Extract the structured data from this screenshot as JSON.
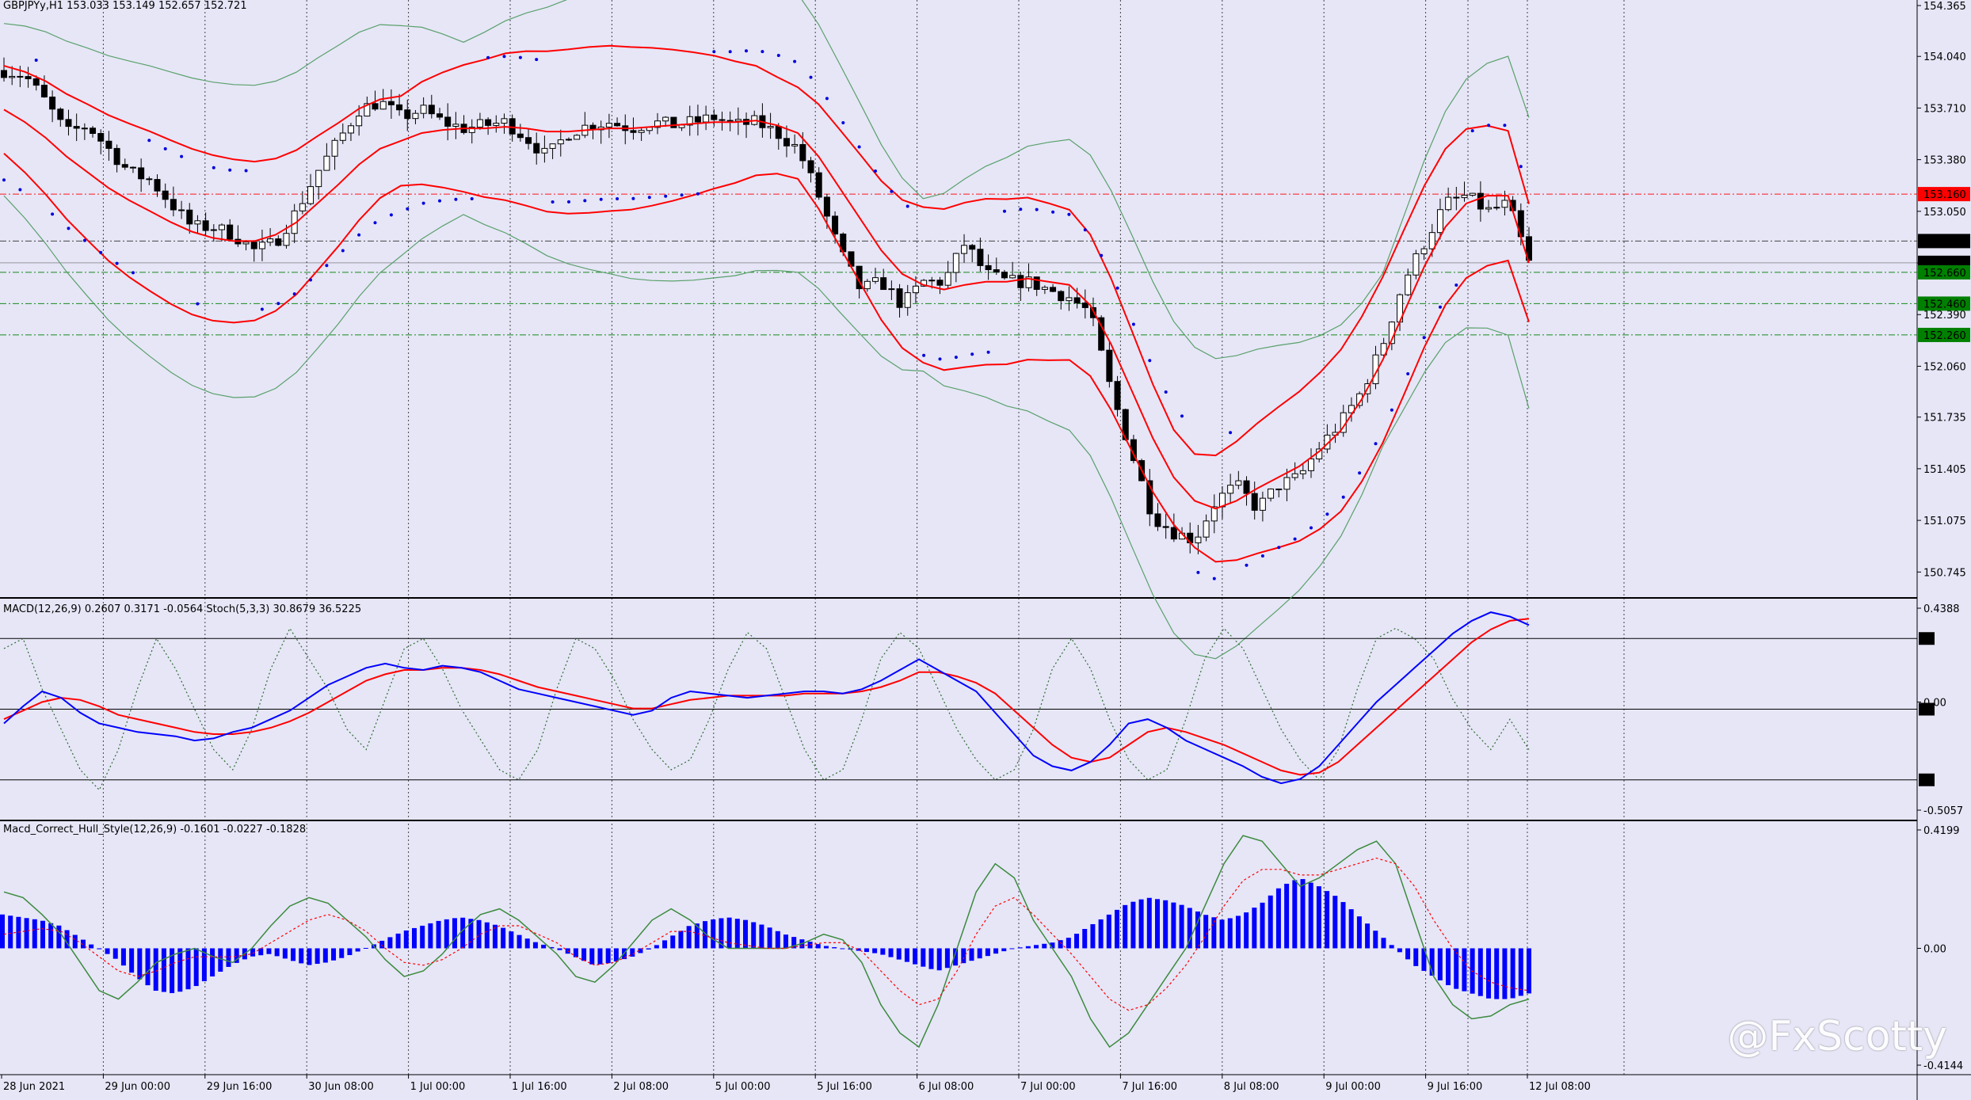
{
  "header": {
    "symbol_line": "GBPJPYy,H1  153.033 153.149 152.657 152.721"
  },
  "indicators": {
    "macd_label": "MACD(12,26,9) 0.2607 0.3171 -0.0564  Stoch(5,3,3) 30.8679 36.5225",
    "hull_label": "Macd_Correct_Hull_Style(12,26,9) -0.1601 -0.0227 -0.1828"
  },
  "watermark": "@FxScotty",
  "colors": {
    "background": "#e6e6f7",
    "bull_candle": "#ffffff",
    "bear_candle": "#000000",
    "ma_red": "#ff0000",
    "bands_green": "#5aa06a",
    "sar_blue": "#0000dd",
    "macd_main": "#0000ff",
    "macd_signal": "#ff0000",
    "stoch_dotted": "#2e6b2e",
    "hist_blue": "#0000ff",
    "marker_red": "#ff0000",
    "marker_black": "#000000",
    "marker_green": "#008000"
  },
  "chart_data": [
    {
      "type": "candlestick",
      "title": "GBPJPYy,H1",
      "y_ticks": [
        "154.365",
        "154.040",
        "153.710",
        "153.380",
        "153.050",
        "152.720",
        "152.390",
        "152.060",
        "151.735",
        "151.405",
        "151.075",
        "150.745"
      ],
      "ylim": [
        150.62,
        154.37
      ],
      "x_ticks": [
        "28 Jun 2021",
        "29 Jun 00:00",
        "29 Jun 16:00",
        "30 Jun 08:00",
        "1 Jul 00:00",
        "1 Jul 16:00",
        "2 Jul 08:00",
        "5 Jul 00:00",
        "5 Jul 16:00",
        "6 Jul 08:00",
        "7 Jul 00:00",
        "7 Jul 16:00",
        "8 Jul 08:00",
        "9 Jul 00:00",
        "9 Jul 16:00",
        "12 Jul 08:00"
      ],
      "price_markers": [
        {
          "value": "153.160",
          "style": "red"
        },
        {
          "value": "152.860",
          "style": "black"
        },
        {
          "value": "152.721",
          "style": "black"
        },
        {
          "value": "152.660",
          "style": "green"
        },
        {
          "value": "152.460",
          "style": "green"
        },
        {
          "value": "152.260",
          "style": "green"
        }
      ],
      "close_path": [
        153.95,
        153.92,
        153.75,
        153.55,
        153.6,
        153.45,
        153.3,
        153.25,
        153.1,
        152.95,
        152.95,
        152.9,
        152.8,
        152.85,
        153.05,
        153.3,
        153.5,
        153.7,
        153.75,
        153.65,
        153.7,
        153.62,
        153.58,
        153.6,
        153.62,
        153.52,
        153.4,
        153.55,
        153.6,
        153.62,
        153.58,
        153.62,
        153.6,
        153.62,
        153.65,
        153.6,
        153.62,
        153.55,
        153.45,
        153.15,
        152.8,
        152.55,
        152.6,
        152.45,
        152.6,
        152.6,
        152.85,
        152.65,
        152.6,
        152.6,
        152.55,
        152.5,
        152.4,
        151.9,
        151.5,
        151.1,
        151.0,
        150.95,
        151.2,
        151.3,
        151.15,
        151.3,
        151.35,
        151.55,
        151.7,
        151.9,
        152.2,
        152.6,
        152.85,
        153.1,
        153.15,
        153.05,
        153.1,
        152.72
      ],
      "series": [
        {
          "name": "MA",
          "values": [
            153.7,
            153.62,
            153.52,
            153.4,
            153.3,
            153.2,
            153.12,
            153.05,
            152.98,
            152.92,
            152.88,
            152.86,
            152.86,
            152.9,
            152.98,
            153.1,
            153.22,
            153.35,
            153.45,
            153.5,
            153.55,
            153.57,
            153.58,
            153.58,
            153.59,
            153.58,
            153.56,
            153.56,
            153.57,
            153.58,
            153.58,
            153.59,
            153.6,
            153.61,
            153.62,
            153.62,
            153.63,
            153.6,
            153.55,
            153.4,
            153.2,
            153.0,
            152.8,
            152.65,
            152.58,
            152.55,
            152.58,
            152.6,
            152.6,
            152.62,
            152.6,
            152.58,
            152.45,
            152.2,
            151.9,
            151.6,
            151.35,
            151.2,
            151.15,
            151.2,
            151.28,
            151.35,
            151.42,
            151.52,
            151.65,
            151.85,
            152.1,
            152.4,
            152.7,
            152.95,
            153.1,
            153.15,
            153.15,
            152.72
          ]
        }
      ]
    },
    {
      "type": "line",
      "title": "MACD(12,26,9) 0.2607 0.3171 -0.0564  Stoch(5,3,3) 30.8679 36.5225",
      "y_ticks": [
        "0.4388",
        "0.00",
        "-0.5057"
      ],
      "levels": [
        "85",
        "50",
        "15"
      ],
      "ylim": [
        -0.5057,
        0.4388
      ],
      "series": [
        {
          "name": "MACD",
          "values": [
            -0.1,
            -0.02,
            0.05,
            0.02,
            -0.05,
            -0.1,
            -0.12,
            -0.14,
            -0.15,
            -0.16,
            -0.18,
            -0.17,
            -0.14,
            -0.12,
            -0.08,
            -0.04,
            0.02,
            0.08,
            0.12,
            0.16,
            0.18,
            0.16,
            0.15,
            0.17,
            0.16,
            0.14,
            0.1,
            0.06,
            0.04,
            0.02,
            0.0,
            -0.02,
            -0.04,
            -0.06,
            -0.04,
            0.02,
            0.05,
            0.04,
            0.03,
            0.02,
            0.03,
            0.04,
            0.05,
            0.05,
            0.04,
            0.06,
            0.1,
            0.15,
            0.2,
            0.15,
            0.1,
            0.05,
            -0.05,
            -0.15,
            -0.25,
            -0.3,
            -0.32,
            -0.28,
            -0.2,
            -0.1,
            -0.08,
            -0.12,
            -0.18,
            -0.22,
            -0.26,
            -0.3,
            -0.35,
            -0.38,
            -0.36,
            -0.3,
            -0.2,
            -0.1,
            0.0,
            0.08,
            0.16,
            0.24,
            0.32,
            0.38,
            0.42,
            0.4,
            0.36
          ]
        },
        {
          "name": "Signal",
          "values": [
            -0.08,
            -0.04,
            0.0,
            0.02,
            0.01,
            -0.02,
            -0.06,
            -0.08,
            -0.1,
            -0.12,
            -0.14,
            -0.15,
            -0.15,
            -0.14,
            -0.12,
            -0.09,
            -0.05,
            0.0,
            0.05,
            0.1,
            0.13,
            0.15,
            0.15,
            0.16,
            0.16,
            0.15,
            0.13,
            0.1,
            0.07,
            0.05,
            0.03,
            0.01,
            -0.01,
            -0.03,
            -0.03,
            -0.01,
            0.01,
            0.02,
            0.03,
            0.03,
            0.03,
            0.03,
            0.04,
            0.04,
            0.04,
            0.05,
            0.07,
            0.1,
            0.14,
            0.14,
            0.12,
            0.09,
            0.04,
            -0.04,
            -0.12,
            -0.2,
            -0.26,
            -0.28,
            -0.26,
            -0.2,
            -0.14,
            -0.12,
            -0.14,
            -0.17,
            -0.2,
            -0.24,
            -0.28,
            -0.32,
            -0.34,
            -0.33,
            -0.28,
            -0.2,
            -0.12,
            -0.04,
            0.04,
            0.12,
            0.2,
            0.28,
            0.34,
            0.38,
            0.39
          ]
        },
        {
          "name": "Stoch",
          "values": [
            80,
            85,
            60,
            40,
            20,
            10,
            30,
            60,
            85,
            70,
            50,
            30,
            20,
            40,
            70,
            90,
            75,
            60,
            40,
            30,
            55,
            80,
            85,
            70,
            50,
            35,
            20,
            15,
            30,
            60,
            85,
            80,
            65,
            45,
            30,
            20,
            25,
            45,
            70,
            88,
            80,
            55,
            30,
            15,
            20,
            45,
            75,
            88,
            80,
            60,
            40,
            25,
            15,
            20,
            40,
            70,
            85,
            70,
            45,
            25,
            15,
            20,
            45,
            75,
            90,
            80,
            60,
            40,
            25,
            15,
            30,
            60,
            85,
            90,
            85,
            75,
            55,
            40,
            30,
            45,
            30
          ]
        }
      ]
    },
    {
      "type": "bar",
      "title": "Macd_Correct_Hull_Style(12,26,9) -0.1601 -0.0227 -0.1828",
      "y_ticks": [
        "0.4199",
        "0.00",
        "-0.4144"
      ],
      "ylim": [
        -0.4144,
        0.4199
      ],
      "series": [
        {
          "name": "Histogram",
          "values": [
            0.12,
            0.11,
            0.1,
            0.08,
            0.04,
            0.0,
            -0.04,
            -0.1,
            -0.15,
            -0.16,
            -0.14,
            -0.1,
            -0.06,
            -0.03,
            -0.02,
            -0.04,
            -0.06,
            -0.05,
            -0.03,
            0.0,
            0.03,
            0.06,
            0.08,
            0.1,
            0.11,
            0.1,
            0.08,
            0.05,
            0.02,
            0.0,
            -0.03,
            -0.06,
            -0.05,
            -0.03,
            0.0,
            0.04,
            0.08,
            0.1,
            0.11,
            0.1,
            0.08,
            0.05,
            0.03,
            0.01,
            0.0,
            -0.01,
            -0.02,
            -0.04,
            -0.06,
            -0.08,
            -0.06,
            -0.04,
            -0.02,
            0.0,
            0.01,
            0.02,
            0.04,
            0.08,
            0.12,
            0.16,
            0.18,
            0.17,
            0.15,
            0.12,
            0.1,
            0.12,
            0.16,
            0.22,
            0.25,
            0.22,
            0.18,
            0.12,
            0.06,
            0.0,
            -0.06,
            -0.1,
            -0.14,
            -0.16,
            -0.18,
            -0.18,
            -0.16
          ]
        },
        {
          "name": "Hull",
          "values": [
            0.2,
            0.18,
            0.12,
            0.05,
            -0.05,
            -0.15,
            -0.18,
            -0.12,
            -0.05,
            -0.02,
            0.0,
            -0.03,
            -0.05,
            0.0,
            0.08,
            0.15,
            0.18,
            0.16,
            0.1,
            0.04,
            -0.04,
            -0.1,
            -0.08,
            -0.02,
            0.06,
            0.12,
            0.14,
            0.1,
            0.04,
            -0.02,
            -0.1,
            -0.12,
            -0.06,
            0.02,
            0.1,
            0.14,
            0.1,
            0.04,
            0.0,
            0.0,
            0.0,
            0.0,
            0.02,
            0.05,
            0.03,
            -0.05,
            -0.2,
            -0.3,
            -0.35,
            -0.2,
            0.0,
            0.2,
            0.3,
            0.25,
            0.1,
            0.0,
            -0.1,
            -0.25,
            -0.35,
            -0.3,
            -0.2,
            -0.1,
            0.0,
            0.15,
            0.3,
            0.4,
            0.38,
            0.3,
            0.22,
            0.25,
            0.3,
            0.35,
            0.38,
            0.3,
            0.1,
            -0.1,
            -0.2,
            -0.25,
            -0.24,
            -0.2,
            -0.18
          ]
        },
        {
          "name": "Signal",
          "values": [
            0.05,
            0.06,
            0.07,
            0.06,
            0.02,
            -0.03,
            -0.08,
            -0.1,
            -0.08,
            -0.05,
            -0.03,
            -0.03,
            -0.03,
            -0.02,
            0.02,
            0.06,
            0.1,
            0.12,
            0.1,
            0.06,
            0.0,
            -0.05,
            -0.06,
            -0.04,
            0.0,
            0.05,
            0.08,
            0.08,
            0.05,
            0.02,
            -0.03,
            -0.06,
            -0.05,
            -0.02,
            0.02,
            0.06,
            0.06,
            0.04,
            0.02,
            0.01,
            0.0,
            0.0,
            0.01,
            0.02,
            0.02,
            -0.01,
            -0.08,
            -0.15,
            -0.2,
            -0.18,
            -0.08,
            0.05,
            0.15,
            0.18,
            0.12,
            0.05,
            -0.02,
            -0.1,
            -0.18,
            -0.22,
            -0.2,
            -0.14,
            -0.06,
            0.04,
            0.15,
            0.24,
            0.28,
            0.28,
            0.26,
            0.26,
            0.28,
            0.3,
            0.32,
            0.3,
            0.22,
            0.1,
            0.0,
            -0.08,
            -0.12,
            -0.14,
            -0.15
          ]
        }
      ]
    }
  ]
}
